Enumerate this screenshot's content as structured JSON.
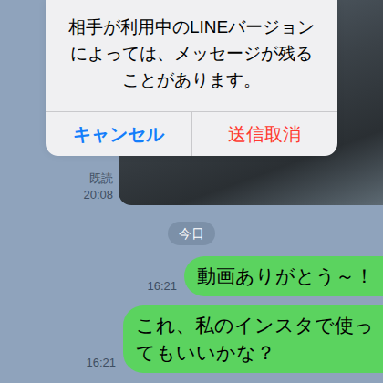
{
  "dialog": {
    "message_lines": [
      "相手が利用中のLINEバージョン",
      "によっては、メッセージが残る",
      "ことがあります。"
    ],
    "buttons": [
      {
        "label": "キャンセル",
        "kind": "cancel"
      },
      {
        "label": "送信取消",
        "kind": "destructive"
      }
    ]
  },
  "earlier": {
    "read": "既読",
    "time": "20:08"
  },
  "date_separator": "今日",
  "messages": [
    {
      "lines": [
        "動画ありがとう～！"
      ],
      "time": "16:21"
    },
    {
      "lines": [
        "これ、私のインスタで使っ",
        "てもいいかな？"
      ],
      "time": "16:21"
    }
  ]
}
